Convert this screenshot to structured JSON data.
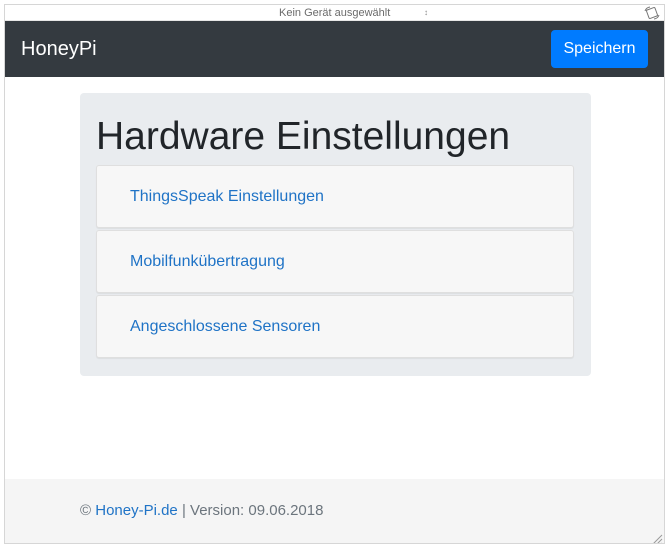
{
  "device_bar": {
    "device_select": "Kein Gerät ausgewählt",
    "caret": "↕"
  },
  "navbar": {
    "brand": "HoneyPi",
    "save_label": "Speichern"
  },
  "main": {
    "title": "Hardware Einstellungen",
    "links": [
      {
        "label": "ThingsSpeak Einstellungen"
      },
      {
        "label": "Mobilfunkübertragung"
      },
      {
        "label": "Angeschlossene Sensoren"
      }
    ]
  },
  "footer": {
    "copyright": "©",
    "link_text": "Honey-Pi.de",
    "version": "| Version: 09.06.2018"
  },
  "colors": {
    "navbar_bg": "#343a40",
    "primary": "#007bff",
    "link": "#1f73c6",
    "jumbotron_bg": "#e9ecef",
    "footer_bg": "#f5f5f5"
  },
  "icons": [
    "rotate-device-icon",
    "resize-grip-icon"
  ]
}
